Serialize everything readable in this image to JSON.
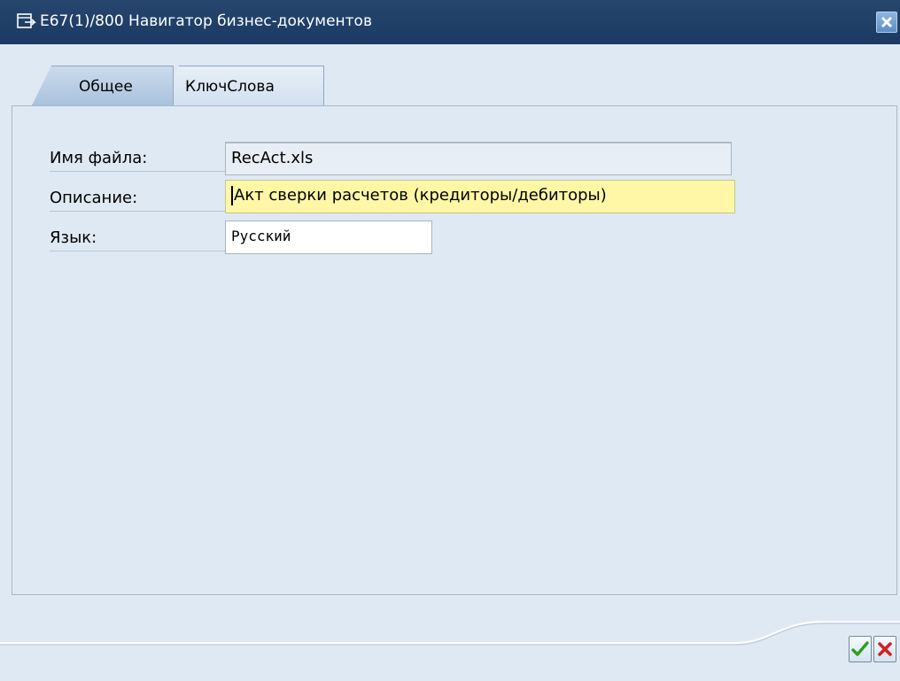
{
  "window": {
    "title": "E67(1)/800 Навигатор бизнес-документов",
    "title_icon": "window-menu-icon",
    "close_icon": "close-icon"
  },
  "tabs": [
    {
      "label": "Общее",
      "active": true
    },
    {
      "label": "КлючСлова",
      "active": false
    }
  ],
  "form": {
    "filename": {
      "label": "Имя файла:",
      "value": "RecAct.xls"
    },
    "description": {
      "label": "Описание:",
      "value": "Акт сверки расчетов (кредиторы/дебиторы)"
    },
    "language": {
      "label": "Язык:",
      "value": "Русский"
    }
  },
  "buttons": {
    "ok_icon": "checkmark-icon",
    "cancel_icon": "cross-icon"
  },
  "colors": {
    "titlebar": "#1b3a63",
    "panel": "#dfe9f4",
    "focused_field": "#fff7a5",
    "focus_marker": "#d41f1f",
    "ok": "#2e9e1e",
    "cancel": "#d42020"
  }
}
